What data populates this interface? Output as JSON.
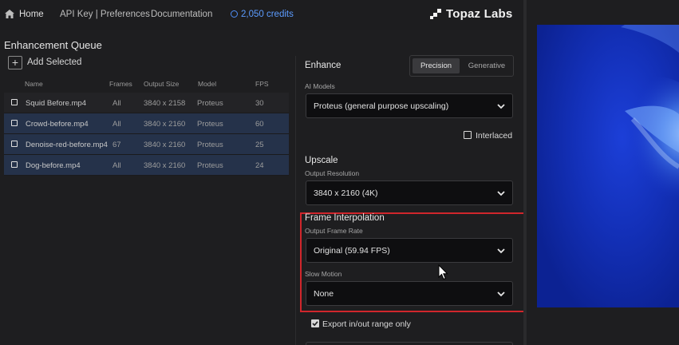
{
  "nav": {
    "home": "Home",
    "api": "API Key | Preferences",
    "docs": "Documentation",
    "credits": "2,050 credits",
    "logo": "Topaz Labs"
  },
  "queue": {
    "title": "Enhancement Queue",
    "add_label": "Add Selected",
    "headers": {
      "name": "Name",
      "frames": "Frames",
      "size": "Output Size",
      "model": "Model",
      "fps": "FPS"
    },
    "rows": [
      {
        "name": "Squid Before.mp4",
        "frames": "All",
        "size": "3840 x 2158",
        "model": "Proteus",
        "fps": "30",
        "selected": false
      },
      {
        "name": "Crowd-before.mp4",
        "frames": "All",
        "size": "3840 x 2160",
        "model": "Proteus",
        "fps": "60",
        "selected": true
      },
      {
        "name": "Denoise-red-before.mp4",
        "frames": "67",
        "size": "3840 x 2160",
        "model": "Proteus",
        "fps": "25",
        "selected": true
      },
      {
        "name": "Dog-before.mp4",
        "frames": "All",
        "size": "3840 x 2160",
        "model": "Proteus",
        "fps": "24",
        "selected": true
      }
    ]
  },
  "enhance": {
    "title": "Enhance",
    "toggle": {
      "precision": "Precision",
      "generative": "Generative",
      "active": "Precision"
    },
    "ai_models_label": "AI Models",
    "model_value": "Proteus (general purpose upscaling)",
    "interlaced_label": "Interlaced",
    "interlaced": false
  },
  "upscale": {
    "title": "Upscale",
    "resolution_label": "Output Resolution",
    "resolution_value": "3840 x 2160 (4K)"
  },
  "interpolation": {
    "title": "Frame Interpolation",
    "frame_rate_label": "Output Frame Rate",
    "frame_rate_value": "Original (59.94 FPS)",
    "slow_motion_label": "Slow Motion",
    "slow_motion_value": "None"
  },
  "export": {
    "range_label": "Export in/out range only",
    "range_only": true
  },
  "colors": {
    "accent": "#5c9cff",
    "highlight": "#d0262c",
    "selected_row": "#25324a",
    "preview": "#1330b8"
  }
}
